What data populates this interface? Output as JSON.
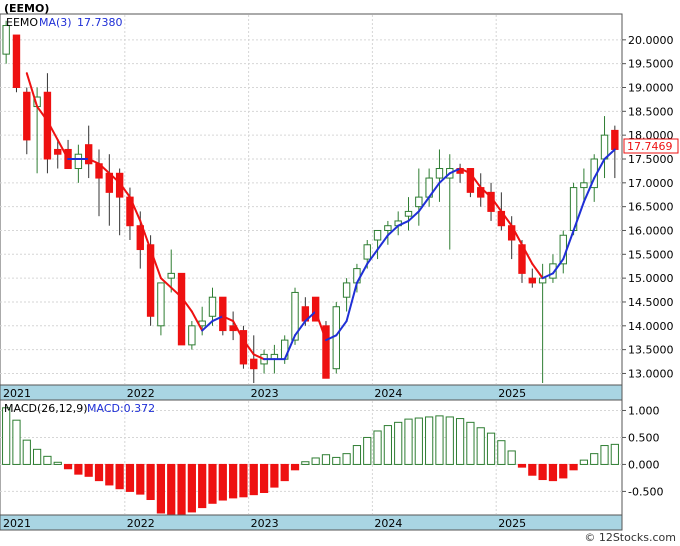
{
  "header": {
    "title": "(EEMO)"
  },
  "price_panel": {
    "legend_symbol": "EEMO",
    "legend_ma": "MA(3)",
    "legend_ma_value": "17.7380",
    "last_price_label": "17.7469"
  },
  "macd_panel": {
    "legend_label": "MACD(26,12,9)",
    "legend_value": "MACD:0.372"
  },
  "footer": {
    "credit": "© 12Stocks.com"
  },
  "colors": {
    "up": "#2e7d32",
    "down": "#ee1111",
    "ma_up": "#1f2fd6",
    "ma_down": "#ee1111",
    "axis_band": "#a9d5e3",
    "last_price": "#ee1111"
  },
  "chart_data": [
    {
      "type": "candlestick",
      "title": "(EEMO)",
      "xlabel": "",
      "ylabel": "",
      "ylim": [
        12.8,
        20.5
      ],
      "yticks": [
        "20.0000",
        "19.5000",
        "19.0000",
        "18.5000",
        "18.0000",
        "17.5000",
        "17.0000",
        "16.5000",
        "16.0000",
        "15.5000",
        "15.0000",
        "14.5000",
        "14.0000",
        "13.5000",
        "13.0000"
      ],
      "x_year_labels": [
        "2021",
        "2022",
        "2023",
        "2024",
        "2025"
      ],
      "series": [
        {
          "name": "EEMO",
          "ohlc": [
            [
              19.7,
              20.4,
              19.5,
              20.3
            ],
            [
              20.1,
              20.1,
              18.9,
              19.0
            ],
            [
              18.9,
              19.0,
              17.6,
              17.9
            ],
            [
              18.6,
              19.0,
              17.2,
              18.8
            ],
            [
              18.9,
              19.3,
              17.2,
              17.5
            ],
            [
              17.7,
              17.9,
              17.3,
              17.6
            ],
            [
              17.7,
              17.9,
              17.3,
              17.3
            ],
            [
              17.3,
              17.8,
              17.0,
              17.6
            ],
            [
              17.8,
              18.2,
              17.1,
              17.4
            ],
            [
              17.4,
              17.7,
              16.3,
              17.1
            ],
            [
              17.2,
              17.6,
              16.1,
              16.8
            ],
            [
              17.2,
              17.3,
              15.9,
              16.7
            ],
            [
              16.7,
              16.9,
              15.8,
              16.1
            ],
            [
              16.1,
              16.4,
              15.2,
              15.6
            ],
            [
              15.7,
              15.9,
              14.0,
              14.2
            ],
            [
              14.0,
              14.9,
              13.8,
              14.9
            ],
            [
              15.0,
              15.6,
              14.7,
              15.1
            ],
            [
              15.1,
              15.1,
              13.6,
              13.6
            ],
            [
              13.6,
              14.1,
              13.5,
              14.0
            ],
            [
              14.0,
              14.4,
              13.8,
              14.1
            ],
            [
              14.2,
              14.8,
              14.0,
              14.6
            ],
            [
              14.6,
              14.6,
              13.8,
              13.9
            ],
            [
              14.0,
              14.3,
              13.7,
              13.9
            ],
            [
              13.9,
              14.0,
              13.1,
              13.2
            ],
            [
              13.3,
              13.8,
              12.8,
              13.1
            ],
            [
              13.2,
              13.5,
              13.0,
              13.4
            ],
            [
              13.3,
              13.6,
              13.0,
              13.4
            ],
            [
              13.3,
              13.8,
              13.2,
              13.7
            ],
            [
              13.7,
              14.8,
              13.6,
              14.7
            ],
            [
              14.4,
              14.6,
              14.0,
              14.1
            ],
            [
              14.6,
              14.6,
              14.1,
              14.1
            ],
            [
              14.0,
              14.1,
              12.9,
              12.9
            ],
            [
              13.1,
              14.5,
              13.0,
              14.4
            ],
            [
              14.6,
              15.0,
              14.3,
              14.9
            ],
            [
              14.9,
              15.3,
              14.7,
              15.2
            ],
            [
              15.4,
              15.8,
              15.2,
              15.7
            ],
            [
              15.8,
              16.0,
              15.4,
              16.0
            ],
            [
              16.0,
              16.2,
              15.7,
              16.1
            ],
            [
              16.1,
              16.4,
              15.9,
              16.2
            ],
            [
              16.3,
              16.7,
              16.0,
              16.4
            ],
            [
              16.5,
              17.3,
              16.1,
              16.7
            ],
            [
              16.7,
              17.3,
              16.5,
              17.1
            ],
            [
              17.1,
              17.7,
              16.6,
              17.3
            ],
            [
              17.1,
              17.6,
              15.6,
              17.3
            ],
            [
              17.3,
              17.4,
              17.0,
              17.2
            ],
            [
              17.3,
              17.3,
              16.7,
              16.8
            ],
            [
              16.9,
              17.2,
              16.5,
              16.7
            ],
            [
              16.8,
              17.0,
              16.2,
              16.4
            ],
            [
              16.4,
              16.8,
              16.0,
              16.1
            ],
            [
              16.1,
              16.3,
              15.4,
              15.8
            ],
            [
              15.7,
              15.8,
              14.9,
              15.1
            ],
            [
              15.0,
              15.2,
              14.8,
              14.9
            ],
            [
              14.9,
              15.3,
              12.8,
              15.0
            ],
            [
              15.0,
              15.5,
              14.9,
              15.3
            ],
            [
              15.3,
              16.0,
              15.1,
              15.9
            ],
            [
              16.0,
              17.0,
              15.9,
              16.9
            ],
            [
              16.9,
              17.3,
              16.6,
              17.0
            ],
            [
              16.9,
              17.6,
              16.6,
              17.5
            ],
            [
              17.5,
              18.4,
              17.1,
              18.0
            ],
            [
              18.1,
              18.2,
              17.1,
              17.7
            ]
          ]
        },
        {
          "name": "MA(3)",
          "values": [
            null,
            null,
            19.3,
            18.6,
            18.3,
            17.9,
            17.5,
            17.5,
            17.5,
            17.4,
            17.2,
            17.0,
            16.7,
            16.2,
            15.6,
            15.0,
            14.8,
            14.6,
            14.3,
            13.9,
            14.1,
            14.2,
            14.1,
            13.7,
            13.4,
            13.3,
            13.3,
            13.3,
            13.8,
            14.1,
            14.3,
            13.7,
            13.8,
            14.1,
            14.9,
            15.3,
            15.6,
            15.9,
            16.1,
            16.2,
            16.4,
            16.7,
            17.0,
            17.2,
            17.3,
            17.2,
            16.9,
            16.7,
            16.4,
            16.1,
            15.7,
            15.3,
            15.0,
            15.1,
            15.4,
            16.0,
            16.6,
            17.1,
            17.5,
            17.7
          ]
        }
      ]
    },
    {
      "type": "bar",
      "title": "MACD(26,12,9)",
      "ylim": [
        -0.9,
        1.12
      ],
      "yticks": [
        "1.000",
        "0.500",
        "0.000",
        "-0.500"
      ],
      "x_year_labels": [
        "2021",
        "2022",
        "2023",
        "2024",
        "2025"
      ],
      "series": [
        {
          "name": "MACD",
          "values": [
            1.05,
            0.82,
            0.45,
            0.28,
            0.15,
            0.04,
            -0.08,
            -0.18,
            -0.22,
            -0.3,
            -0.38,
            -0.45,
            -0.5,
            -0.55,
            -0.65,
            -0.9,
            -0.93,
            -0.95,
            -0.88,
            -0.8,
            -0.72,
            -0.66,
            -0.62,
            -0.6,
            -0.56,
            -0.52,
            -0.42,
            -0.3,
            -0.1,
            0.05,
            0.12,
            0.18,
            0.13,
            0.2,
            0.35,
            0.5,
            0.62,
            0.72,
            0.78,
            0.84,
            0.86,
            0.88,
            0.9,
            0.88,
            0.85,
            0.78,
            0.68,
            0.58,
            0.44,
            0.25,
            -0.05,
            -0.2,
            -0.28,
            -0.3,
            -0.25,
            -0.1,
            0.08,
            0.2,
            0.35,
            0.372
          ]
        }
      ]
    }
  ]
}
